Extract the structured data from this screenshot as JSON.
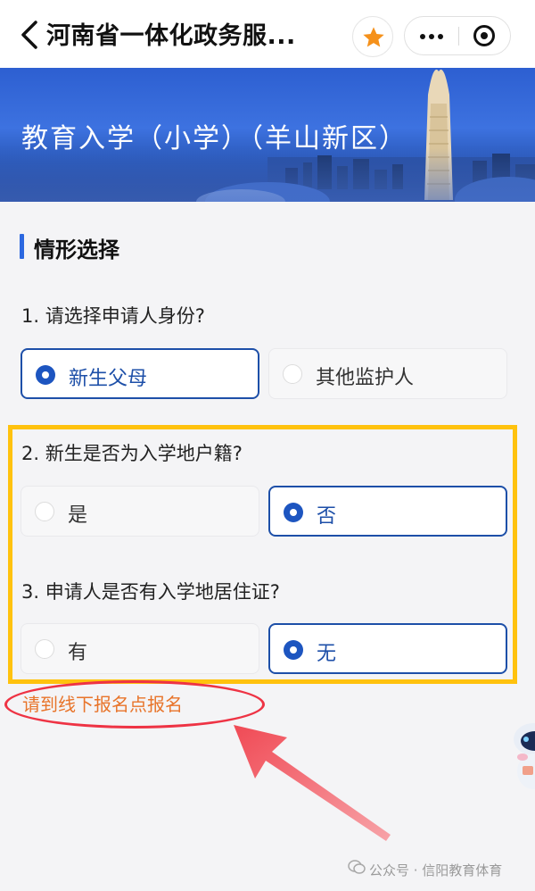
{
  "nav": {
    "title": "河南省一体化政务服...",
    "icons": [
      "back-chevron-icon",
      "star-icon",
      "more-icon",
      "close-target-icon"
    ],
    "star_color": "#f5911b"
  },
  "banner": {
    "title": "教育入学（小学）（羊山新区）"
  },
  "section": {
    "title": "情形选择"
  },
  "questions": [
    {
      "label": "1. 请选择申请人身份?",
      "options": [
        {
          "label": "新生父母",
          "selected": true
        },
        {
          "label": "其他监护人",
          "selected": false
        }
      ]
    },
    {
      "label": "2. 新生是否为入学地户籍?",
      "options": [
        {
          "label": "是",
          "selected": false
        },
        {
          "label": "否",
          "selected": true
        }
      ]
    },
    {
      "label": "3. 申请人是否有入学地居住证?",
      "options": [
        {
          "label": "有",
          "selected": false
        },
        {
          "label": "无",
          "selected": true
        }
      ]
    }
  ],
  "notice": "请到线下报名点报名",
  "colors": {
    "accent": "#1d4fa8",
    "highlight_box": "#ffc20e",
    "notice": "#e8742a",
    "annotation": "#ee3344"
  },
  "footer": {
    "text": "公众号 · 信阳教育体育"
  }
}
